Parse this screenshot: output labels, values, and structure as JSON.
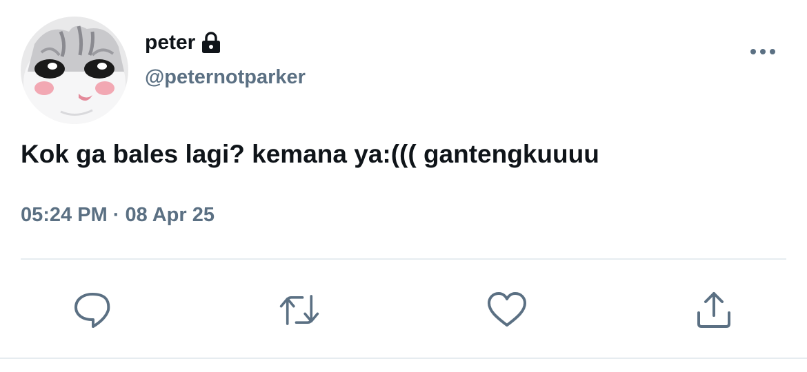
{
  "user": {
    "display_name": "peter",
    "handle": "@peternotparker",
    "protected_icon": "lock-icon",
    "avatar_icon": "cat-avatar"
  },
  "tweet": {
    "text": "Kok ga bales lagi? kemana ya:((( gantengkuuuu",
    "timestamp": "05:24 PM · 08 Apr 25"
  },
  "actions": [
    {
      "name": "reply",
      "icon": "comment-icon"
    },
    {
      "name": "retweet",
      "icon": "retweet-icon"
    },
    {
      "name": "like",
      "icon": "heart-icon"
    },
    {
      "name": "share",
      "icon": "share-icon"
    }
  ],
  "menu_icon": "more-dots-icon",
  "colors": {
    "text": "#0f1419",
    "secondary": "#5b7083",
    "divider": "#e6ecf0",
    "background": "#ffffff"
  }
}
